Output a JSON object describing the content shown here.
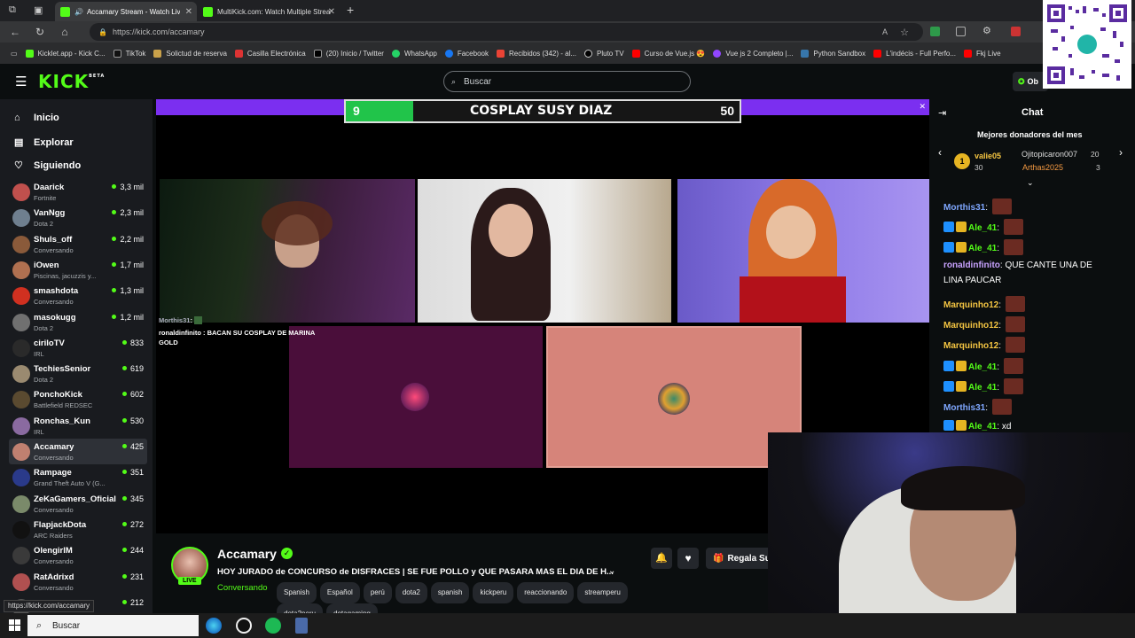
{
  "browser": {
    "tabs": [
      {
        "title": "Accamary Stream - Watch Live",
        "active": true
      },
      {
        "title": "MultiKick.com: Watch Multiple Streams",
        "active": false
      }
    ],
    "url": "https://kick.com/accamary",
    "status_url": "https://kick.com/accamary",
    "bookmarks": [
      "Kicklet.app - Kick C...",
      "TikTok",
      "Solictud de reserva",
      "Casilla Electrónica",
      "(20) Inicio / Twitter",
      "WhatsApp",
      "Facebook",
      "Recibidos (342) - al...",
      "Pluto TV",
      "Curso de Vue.js 😍",
      "Vue js 2 Completo |...",
      "Python Sandbox",
      "L'indécis - Full Perfo...",
      "Fkj Live"
    ]
  },
  "kick": {
    "logo": "KICK",
    "logo_badge": "BETA",
    "search_placeholder": "Buscar",
    "obtain_label": "Ob",
    "nav": {
      "home": "Inicio",
      "explore": "Explorar",
      "following": "Siguiendo"
    },
    "channels": [
      {
        "name": "Daarick",
        "game": "Fortnite",
        "viewers": "3,3 mil",
        "color": "#c0504d"
      },
      {
        "name": "VanNgg",
        "game": "Dota 2",
        "viewers": "2,3 mil",
        "color": "#6f7f8f"
      },
      {
        "name": "Shuls_off",
        "game": "Conversando",
        "viewers": "2,2 mil",
        "color": "#8a5a3a"
      },
      {
        "name": "iOwen",
        "game": "Piscinas, jacuzzis y...",
        "viewers": "1,7 mil",
        "color": "#b07050"
      },
      {
        "name": "smashdota",
        "game": "Conversando",
        "viewers": "1,3 mil",
        "color": "#d03020"
      },
      {
        "name": "masokugg",
        "game": "Dota 2",
        "viewers": "1,2 mil",
        "color": "#707070"
      },
      {
        "name": "ciriloTV",
        "game": "IRL",
        "viewers": "833",
        "color": "#2a2a2a"
      },
      {
        "name": "TechiesSenior",
        "game": "Dota 2",
        "viewers": "619",
        "color": "#9a8a70"
      },
      {
        "name": "PonchoKick",
        "game": "Battlefield REDSEC",
        "viewers": "602",
        "color": "#5a4a30"
      },
      {
        "name": "Ronchas_Kun",
        "game": "IRL",
        "viewers": "530",
        "color": "#8a6aa0"
      },
      {
        "name": "Accamary",
        "game": "Conversando",
        "viewers": "425",
        "color": "#c08070",
        "selected": true
      },
      {
        "name": "Rampage",
        "game": "Grand Theft Auto V (G...",
        "viewers": "351",
        "color": "#2a3a8a"
      },
      {
        "name": "ZeKaGamers_Oficial",
        "game": "Conversando",
        "viewers": "345",
        "color": "#7a8a6a"
      },
      {
        "name": "FlapjackDota",
        "game": "ARC Raiders",
        "viewers": "272",
        "color": "#111111"
      },
      {
        "name": "OlengirlM",
        "game": "Conversando",
        "viewers": "244",
        "color": "#3a3a3a"
      },
      {
        "name": "RatAdrixd",
        "game": "Conversando",
        "viewers": "231",
        "color": "#b05050"
      },
      {
        "name": "",
        "game": "",
        "viewers": "212",
        "color": "#555555"
      }
    ]
  },
  "video": {
    "scoreboard": {
      "left": "9",
      "title": "COSPLAY SUSY DIAZ",
      "right": "50"
    },
    "overlay_chat": [
      {
        "user": "Morthis31",
        "text": ""
      },
      {
        "user": "ronaldinfinito",
        "text": "BACAN SU COSPLAY DE MARINA GOLD"
      }
    ]
  },
  "stream": {
    "channel": "Accamary",
    "live_badge": "LIVE",
    "title": "HOY JURADO de CONCURSO de DISFRACES | SE FUE POLLO y QUE PASARA MAS EL DIA DE H...",
    "category": "Conversando",
    "tags": [
      "Spanish",
      "Español",
      "perú",
      "dota2",
      "spanish",
      "kickperu",
      "reaccionando",
      "streamperu",
      "dota2peru",
      "dotagaming"
    ],
    "gift_label": "Regala Su"
  },
  "chat": {
    "header": "Chat",
    "top_donors_title": "Mejores donadores del mes",
    "donors": [
      {
        "rank": "1",
        "name": "valie05",
        "amount": "30"
      },
      {
        "name": "Ojitopicaron007",
        "amount": "20"
      },
      {
        "name": "Arthas2025",
        "amount": "3"
      }
    ],
    "messages": [
      {
        "user": "Morthis31",
        "text": "",
        "color": "#7fa7ff",
        "badges": false,
        "emote": true
      },
      {
        "user": "Ale_41",
        "text": "",
        "color": "#53fc18",
        "badges": true,
        "emote": true
      },
      {
        "user": "Ale_41",
        "text": "",
        "color": "#53fc18",
        "badges": true,
        "emote": true
      },
      {
        "user": "ronaldinfinito",
        "text": "QUE CANTE UNA DE",
        "color": "#c8a2ff",
        "badges": false,
        "emote": false
      },
      {
        "user": "",
        "text": "LINA PAUCAR",
        "color": "#fff",
        "badges": false,
        "emote": false
      },
      {
        "user": "Marquinho12",
        "text": "",
        "color": "#f5c542",
        "badges": false,
        "emote": true
      },
      {
        "user": "Marquinho12",
        "text": "",
        "color": "#f5c542",
        "badges": false,
        "emote": true
      },
      {
        "user": "Marquinho12",
        "text": "",
        "color": "#f5c542",
        "badges": false,
        "emote": true
      },
      {
        "user": "Ale_41",
        "text": "",
        "color": "#53fc18",
        "badges": true,
        "emote": true
      },
      {
        "user": "Ale_41",
        "text": "",
        "color": "#53fc18",
        "badges": true,
        "emote": true
      },
      {
        "user": "Morthis31",
        "text": "",
        "color": "#7fa7ff",
        "badges": false,
        "emote": true
      },
      {
        "user": "Ale_41",
        "text": "xd",
        "color": "#53fc18",
        "badges": true,
        "emote": false
      }
    ]
  },
  "taskbar": {
    "search_label": "Buscar"
  },
  "colors": {
    "kick_green": "#53fc18",
    "bg": "#0b0e0f",
    "sidebar": "#191b1f"
  }
}
